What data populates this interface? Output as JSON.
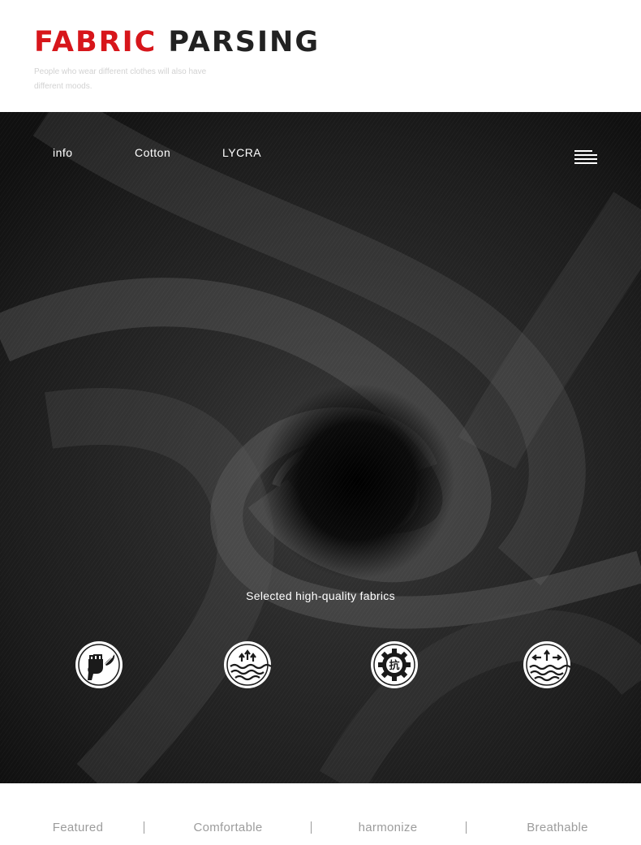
{
  "header": {
    "title_red": "FABRIC",
    "title_dark": "PARSING",
    "subtitle": "People who wear different clothes will also have different moods."
  },
  "nav": {
    "items": [
      "info",
      "Cotton",
      "LYCRA"
    ],
    "menu_icon": "hamburger-menu-icon"
  },
  "main": {
    "tagline": "Selected high-quality fabrics",
    "features": [
      {
        "icon": "fist-leaf-icon"
      },
      {
        "icon": "arrows-water-icon"
      },
      {
        "icon": "anti-gear-icon",
        "glyph": "抗"
      },
      {
        "icon": "breathable-water-icon"
      }
    ]
  },
  "footer": {
    "items": [
      "Featured",
      "Comfortable",
      "harmonize",
      "Breathable"
    ]
  },
  "colors": {
    "accent_red": "#d7161b",
    "title_dark": "#222222",
    "fabric_black": "#1b1b1b",
    "footer_text": "#9c9c9c"
  }
}
